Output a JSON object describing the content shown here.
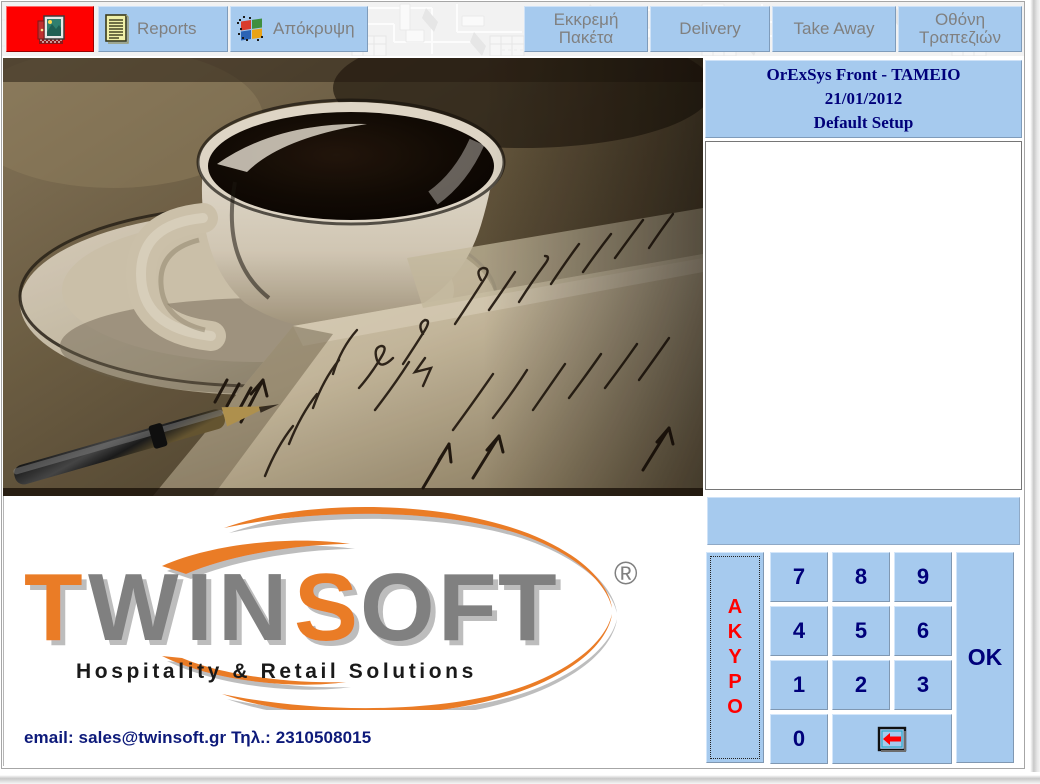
{
  "toolbar": {
    "exit": {
      "label": "",
      "icon": "exit-door-icon"
    },
    "reports": {
      "label": "Reports",
      "icon": "document-icon"
    },
    "hide": {
      "label": "Απόκρυψη",
      "icon": "windows-flag-icon"
    },
    "pending_packets": {
      "label": "Εκκρεμή\nΠακέτα"
    },
    "delivery": {
      "label": "Delivery"
    },
    "take_away": {
      "label": "Take Away"
    },
    "tables_screen": {
      "label": "Οθόνη\nΤραπεζιών"
    }
  },
  "info_header": {
    "title": "OrExSys Front - ΤΑΜΕΙΟ",
    "date": "21/01/2012",
    "setup": "Default Setup"
  },
  "order_display": {
    "content": ""
  },
  "amount_display": {
    "value": "",
    "placeholder": ""
  },
  "keypad": {
    "cancel_label": "ΑΚΥΡΟ",
    "cancel_letters": [
      "Α",
      "Κ",
      "Υ",
      "Ρ",
      "Ο"
    ],
    "keys": [
      "7",
      "8",
      "9",
      "4",
      "5",
      "6",
      "1",
      "2",
      "3",
      "0"
    ],
    "backspace_icon": "backspace-arrow-icon",
    "ok_label": "OK"
  },
  "branding": {
    "logo_text_part1": "T",
    "logo_text_part2": "WIN",
    "logo_text_part3": "S",
    "logo_text_part4": "OFT",
    "logo_full": "TWINSOFT",
    "registered_mark": "®",
    "tagline": "Hospitality & Retail Solutions",
    "contact": "email: sales@twinsoft.gr Τηλ.: 2310508015"
  },
  "photo": {
    "alt": "Sepia photograph of a coffee cup on a saucer beside a handwritten notepad and pen"
  },
  "colors": {
    "button_blue": "#a6caee",
    "navy_text": "#00007a",
    "exit_red": "#fe0000",
    "cancel_red": "#ff0000",
    "logo_orange": "#ea7b28",
    "logo_gray": "#808080",
    "toolbar_bg": "#f2f2f2"
  }
}
